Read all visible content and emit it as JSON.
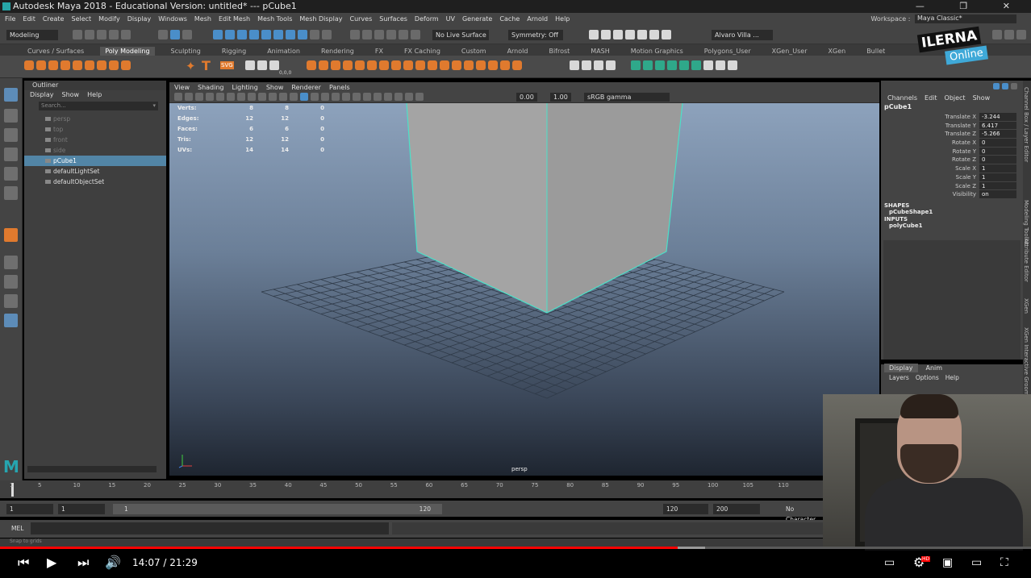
{
  "window": {
    "title": "Autodesk Maya 2018 - Educational Version: untitled*   ---   pCube1",
    "controls": [
      "—",
      "❐",
      "✕"
    ]
  },
  "menubar": [
    "File",
    "Edit",
    "Create",
    "Select",
    "Modify",
    "Display",
    "Windows",
    "Mesh",
    "Edit Mesh",
    "Mesh Tools",
    "Mesh Display",
    "Curves",
    "Surfaces",
    "Deform",
    "UV",
    "Generate",
    "Cache",
    "Arnold",
    "Help"
  ],
  "workspace": {
    "label": "Workspace :",
    "value": "Maya Classic*"
  },
  "statusline": {
    "mode": "Modeling",
    "live_surface": "No Live Surface",
    "symmetry": "Symmetry: Off",
    "user": "Alvaro Villa ..."
  },
  "shelf_tabs": [
    {
      "label": "Curves / Surfaces",
      "active": false
    },
    {
      "label": "Poly Modeling",
      "active": true
    },
    {
      "label": "Sculpting",
      "active": false
    },
    {
      "label": "Rigging",
      "active": false
    },
    {
      "label": "Animation",
      "active": false
    },
    {
      "label": "Rendering",
      "active": false
    },
    {
      "label": "FX",
      "active": false
    },
    {
      "label": "FX Caching",
      "active": false
    },
    {
      "label": "Custom",
      "active": false
    },
    {
      "label": "Arnold",
      "active": false
    },
    {
      "label": "Bifrost",
      "active": false
    },
    {
      "label": "MASH",
      "active": false
    },
    {
      "label": "Motion Graphics",
      "active": false
    },
    {
      "label": "Polygons_User",
      "active": false
    },
    {
      "label": "XGen_User",
      "active": false
    },
    {
      "label": "XGen",
      "active": false
    },
    {
      "label": "Bullet",
      "active": false
    }
  ],
  "shelf_icon_labels": {
    "text_tool": "T",
    "svg_tool": "SVG",
    "sphere_count": "0,0,0"
  },
  "outliner": {
    "title": "Outliner",
    "menu": [
      "Display",
      "Show",
      "Help"
    ],
    "search_placeholder": "Search...",
    "items": [
      {
        "label": "persp",
        "kind": "camera",
        "selected": false
      },
      {
        "label": "top",
        "kind": "camera",
        "selected": false
      },
      {
        "label": "front",
        "kind": "camera",
        "selected": false
      },
      {
        "label": "side",
        "kind": "camera",
        "selected": false
      },
      {
        "label": "pCube1",
        "kind": "mesh",
        "selected": true
      },
      {
        "label": "defaultLightSet",
        "kind": "set",
        "selected": false
      },
      {
        "label": "defaultObjectSet",
        "kind": "set",
        "selected": false
      }
    ]
  },
  "viewport": {
    "menu": [
      "View",
      "Shading",
      "Lighting",
      "Show",
      "Renderer",
      "Panels"
    ],
    "toolbar": {
      "exposure": "0.00",
      "gamma": "1.00",
      "color_space": "sRGB gamma"
    },
    "camera": "persp",
    "hud": [
      {
        "label": "Verts:",
        "a": "8",
        "b": "8",
        "c": "0"
      },
      {
        "label": "Edges:",
        "a": "12",
        "b": "12",
        "c": "0"
      },
      {
        "label": "Faces:",
        "a": "6",
        "b": "6",
        "c": "0"
      },
      {
        "label": "Tris:",
        "a": "12",
        "b": "12",
        "c": "0"
      },
      {
        "label": "UVs:",
        "a": "14",
        "b": "14",
        "c": "0"
      }
    ]
  },
  "channelbox": {
    "menu": [
      "Channels",
      "Edit",
      "Object",
      "Show"
    ],
    "object": "pCube1",
    "channels": [
      {
        "label": "Translate X",
        "value": "-3.244"
      },
      {
        "label": "Translate Y",
        "value": "6.417"
      },
      {
        "label": "Translate Z",
        "value": "-5.266"
      },
      {
        "label": "Rotate X",
        "value": "0"
      },
      {
        "label": "Rotate Y",
        "value": "0"
      },
      {
        "label": "Rotate Z",
        "value": "0"
      },
      {
        "label": "Scale X",
        "value": "1"
      },
      {
        "label": "Scale Y",
        "value": "1"
      },
      {
        "label": "Scale Z",
        "value": "1"
      },
      {
        "label": "Visibility",
        "value": "on"
      }
    ],
    "shapes_header": "SHAPES",
    "shape": "pCubeShape1",
    "inputs_header": "INPUTS",
    "input": "polyCube1"
  },
  "side_tabs": [
    "Channel Box / Layer Editor",
    "Modeling Toolkit",
    "Attribute Editor",
    "XGen",
    "XGen Interactive Groom"
  ],
  "layer_editor": {
    "tabs": [
      {
        "label": "Display",
        "active": true
      },
      {
        "label": "Anim",
        "active": false
      }
    ],
    "menu": [
      "Layers",
      "Options",
      "Help"
    ]
  },
  "timeslider": {
    "ticks": [
      "1",
      "5",
      "10",
      "15",
      "20",
      "25",
      "30",
      "35",
      "40",
      "45",
      "50",
      "55",
      "60",
      "65",
      "70",
      "75",
      "80",
      "85",
      "90",
      "95",
      "100",
      "105",
      "110"
    ],
    "tick_frames": [
      1,
      5,
      10,
      15,
      20,
      25,
      30,
      35,
      40,
      45,
      50,
      55,
      60,
      65,
      70,
      75,
      80,
      85,
      90,
      95,
      100,
      105,
      110
    ],
    "min": 1,
    "max": 115
  },
  "range": {
    "start": "1",
    "current": "1",
    "slider_start": "1",
    "slider_end": "120",
    "end": "120",
    "anim_end": "200",
    "character": "No Character"
  },
  "cmdline": {
    "label": "MEL"
  },
  "helpline": "Snap to grids",
  "ilerna": {
    "word": "ILERNA",
    "sub": "Online"
  },
  "player": {
    "time": "14:07 / 21:29",
    "played_fraction": 0.657,
    "buffered_fraction": 0.684,
    "hd_badge": "HD",
    "colors": {
      "played": "#ff0000"
    }
  }
}
